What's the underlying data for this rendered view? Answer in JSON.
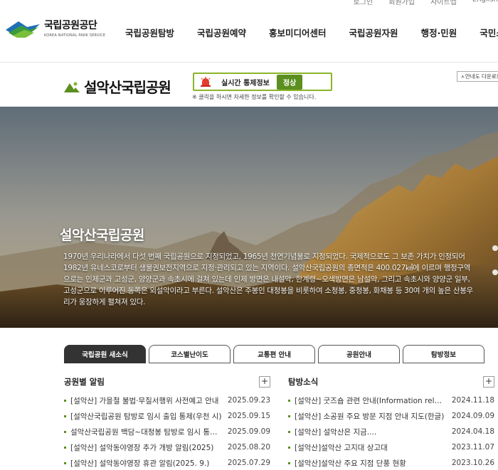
{
  "util_links": [
    "로그인",
    "회원가입",
    "사이트맵",
    "English"
  ],
  "logo": {
    "name": "국립공원공단",
    "sub": "KOREA NATIONAL PARK SERVICE"
  },
  "gnb": [
    "국립공원탐방",
    "국립공원예약",
    "홍보미디어센터",
    "국립공원자원",
    "행정·민원",
    "국민소통"
  ],
  "park": {
    "title": "설악산국립공원",
    "status_label": "실시간 통제정보",
    "status_value": "정상",
    "status_note": "※ 클릭을 하시면 자세한 정보를 확인할 수 있습니다.",
    "guide_button": "ㅅ안내도 다운로드"
  },
  "hero": {
    "title": "설악산국립공원",
    "description": "1970년 우리나라에서 다섯 번째 국립공원으로 지정되었고, 1965년 천연기념물로 지정되었다. 국제적으로도 그 보존 가치가 인정되어 1982년 유네스코로부터 생물권보전지역으로 지정·관리되고 있는 지역이다. 설악산국립공원의 총면적은 400.027㎢에 이르며 행정구역으로는 인제군과 고성군, 양양군과 속초시에 걸쳐 있는데 인제 방면은 내설악, 한계령~오색방면은 남설악, 그리고 속초시와 양양군 일부, 고성군으로 이루어진 동쪽은 외설악이라고 부른다. 설악산은 주봉인 대청봉을 비롯하여 소청봉, 중청봉, 화채봉 등 30여 개의 높은 산봉우리가 웅장하게 펼쳐져 있다."
  },
  "tabs": [
    {
      "label": "국립공원 새소식",
      "active": true
    },
    {
      "label": "코스별난이도",
      "active": false
    },
    {
      "label": "교통편 안내",
      "active": false
    },
    {
      "label": "공원안내",
      "active": false
    },
    {
      "label": "탐방정보",
      "active": false
    }
  ],
  "notice": {
    "title": "공원별 알림",
    "items": [
      {
        "title": "[설악산] 가을철 불법·무질서행위 사전예고 안내",
        "date": "2025.09.23"
      },
      {
        "title": "[설악산국립공원 탐방로 임시 출입 통제(우천 시)",
        "date": "2025.09.15"
      },
      {
        "title": "설악산국립공원 백담~대청봉 탐방로 임시 통제 안내",
        "date": "2025.09.09"
      },
      {
        "title": "[설악산] 설악동야영장 추가 개방 알림(2025)",
        "date": "2025.08.20"
      },
      {
        "title": "[설악산] 설악동야영장 휴관 알림(2025. 9.)",
        "date": "2025.07.29"
      }
    ]
  },
  "tour": {
    "title": "탐방소식",
    "items": [
      {
        "title": "[설악산] 굿즈숍 관련 안내(Information related)",
        "date": "2024.11.18"
      },
      {
        "title": "[설악산] 소공원 주요 방문 지점 안내 지도(한글)",
        "date": "2024.09.09"
      },
      {
        "title": "[설악산] 설악산은 지금....",
        "date": "2024.04.18"
      },
      {
        "title": "[설악산]설악산 고지대 상고대",
        "date": "2023.11.07"
      },
      {
        "title": "[설악산]설악산 주요 지점 단풍 현황",
        "date": "2023.10.26"
      }
    ]
  },
  "colors": {
    "accent": "#5b8f1f",
    "status_border": "#8ab52a",
    "active_tab": "#333333"
  }
}
